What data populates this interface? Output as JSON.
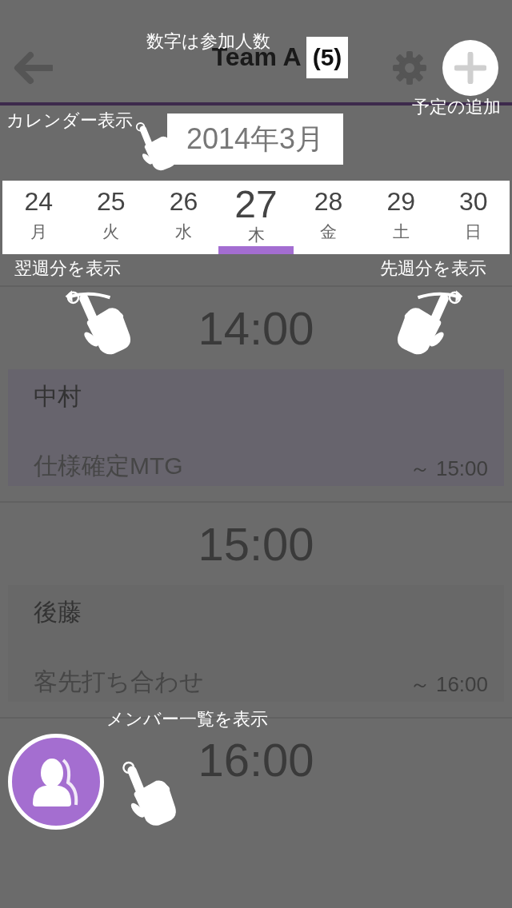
{
  "header": {
    "title": "Team A",
    "count": "(5)"
  },
  "month": "2014年3月",
  "days": [
    {
      "date": "24",
      "weekday": "月",
      "selected": false
    },
    {
      "date": "25",
      "weekday": "火",
      "selected": false
    },
    {
      "date": "26",
      "weekday": "水",
      "selected": false
    },
    {
      "date": "27",
      "weekday": "木",
      "selected": true
    },
    {
      "date": "28",
      "weekday": "金",
      "selected": false
    },
    {
      "date": "29",
      "weekday": "土",
      "selected": false
    },
    {
      "date": "30",
      "weekday": "日",
      "selected": false
    }
  ],
  "timeline": [
    {
      "time": "14:00",
      "event": {
        "name": "中村",
        "title": "仕様確定MTG",
        "end": "～ 15:00",
        "color": "#67646d"
      }
    },
    {
      "time": "15:00",
      "event": {
        "name": "後藤",
        "title": "客先打ち合わせ",
        "end": "～ 16:00",
        "color": "#686868"
      }
    },
    {
      "time": "16:00"
    }
  ],
  "hints": [
    {
      "kind": "count",
      "text": "数字は参加人数"
    },
    {
      "kind": "add",
      "text": "予定の追加"
    },
    {
      "kind": "calendar",
      "text": "カレンダー表示"
    },
    {
      "kind": "next_week",
      "text": "翌週分を表示"
    },
    {
      "kind": "prev_week",
      "text": "先週分を表示"
    },
    {
      "kind": "members",
      "text": "メンバー一覧を表示"
    }
  ]
}
